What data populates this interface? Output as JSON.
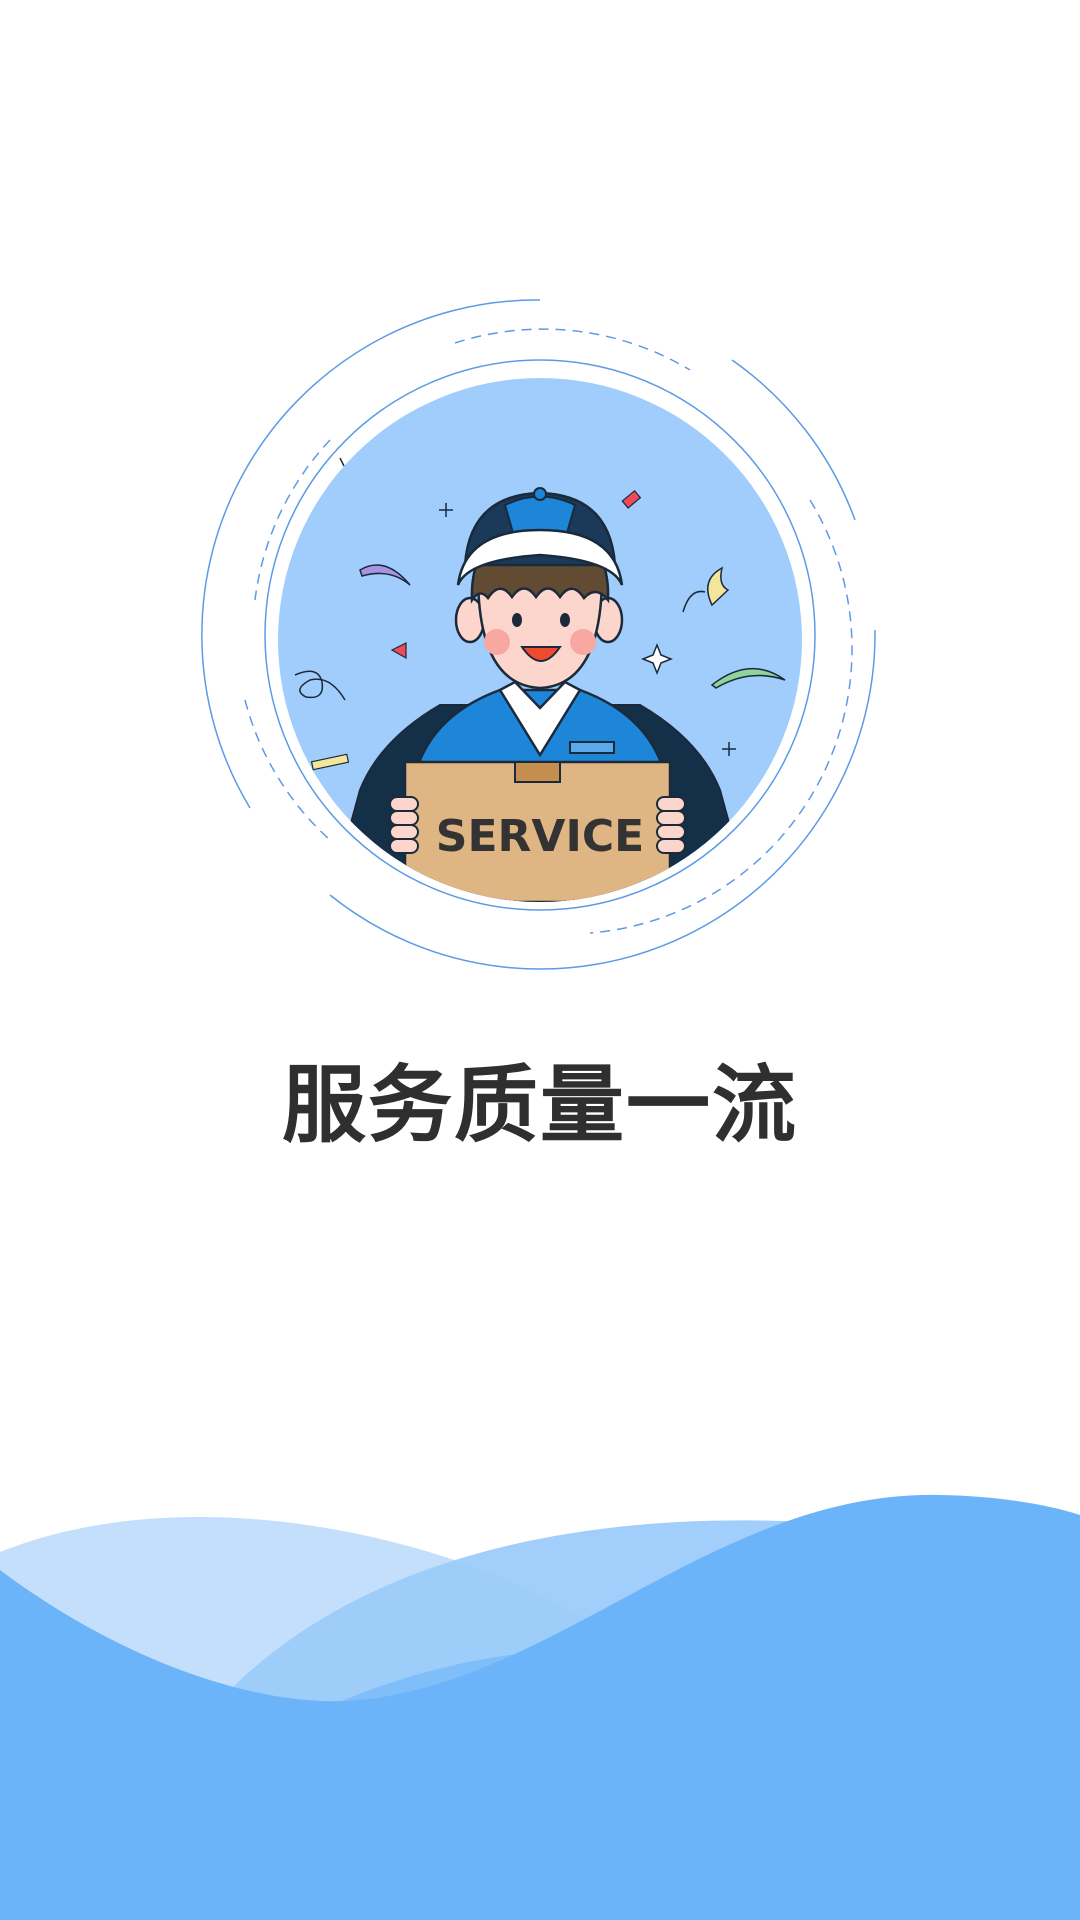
{
  "illustration": {
    "box_label": "SERVICE",
    "ring_color": "#5b9be6",
    "circle_fill": "#a0cdfb",
    "uniform_color": "#1e86d8",
    "box_color": "#e0b584"
  },
  "headline": "服务质量一流",
  "waves": {
    "light_color": "#c3dffb",
    "mid_color": "#9ccbfa",
    "main_color": "#6cb4fa"
  }
}
